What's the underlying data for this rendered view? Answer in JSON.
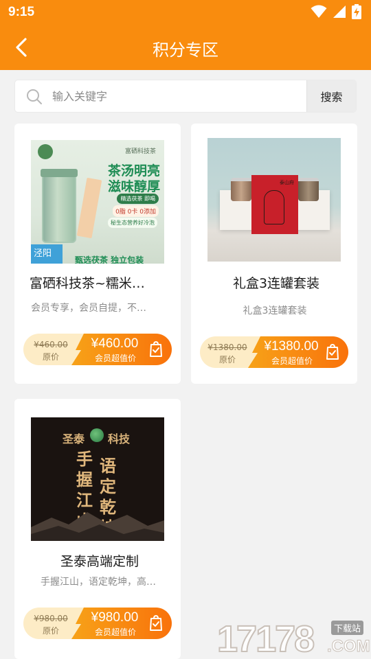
{
  "status_bar": {
    "time": "9:15"
  },
  "app_bar": {
    "title": "积分专区"
  },
  "search": {
    "placeholder": "输入关键字",
    "button_label": "搜索"
  },
  "products": [
    {
      "title": "富硒科技茶~糯米…",
      "description": "会员专享，会员自提，不…",
      "original_price": "¥460.00",
      "original_label": "原价",
      "member_price": "¥460.00",
      "member_label": "会员超值价",
      "image_text": {
        "brand": "富硒科技茶",
        "slogan_1": "茶汤明亮",
        "slogan_2": "滋味醇厚",
        "tag": "精选茯茶 即喝",
        "badges": "0脂 0卡 0添加",
        "note": "秘生态营养好冷泡",
        "corner": "泾阳",
        "bottom": "甄选茯茶 独立包装"
      }
    },
    {
      "title": "礼盒3连罐套装",
      "description": "礼盒3连罐套装",
      "original_price": "¥1380.00",
      "original_label": "原价",
      "member_price": "¥1380.00",
      "member_label": "会员超值价",
      "image_text": {
        "box_label": "泰山府"
      }
    },
    {
      "title": "圣泰高端定制",
      "description": "手握江山，语定乾坤，高…",
      "original_price": "¥980.00",
      "original_label": "原价",
      "member_price": "¥980.00",
      "member_label": "会员超值价",
      "image_text": {
        "brand_left": "圣泰",
        "brand_right": "科技",
        "calligraphy_1": "手握江山",
        "calligraphy_2": "语定乾坤"
      }
    }
  ],
  "watermark": {
    "number": "17178",
    "badge": "下载站",
    "domain": ".COM"
  },
  "colors": {
    "accent": "#f98c0e",
    "price_gradient_start": "#f7a218",
    "price_gradient_end": "#f9720b",
    "pill_bg": "#fdecc6"
  },
  "icons": [
    "wifi-icon",
    "signal-icon",
    "battery-charging-icon",
    "back-arrow-icon",
    "search-icon",
    "shopping-bag-check-icon"
  ]
}
